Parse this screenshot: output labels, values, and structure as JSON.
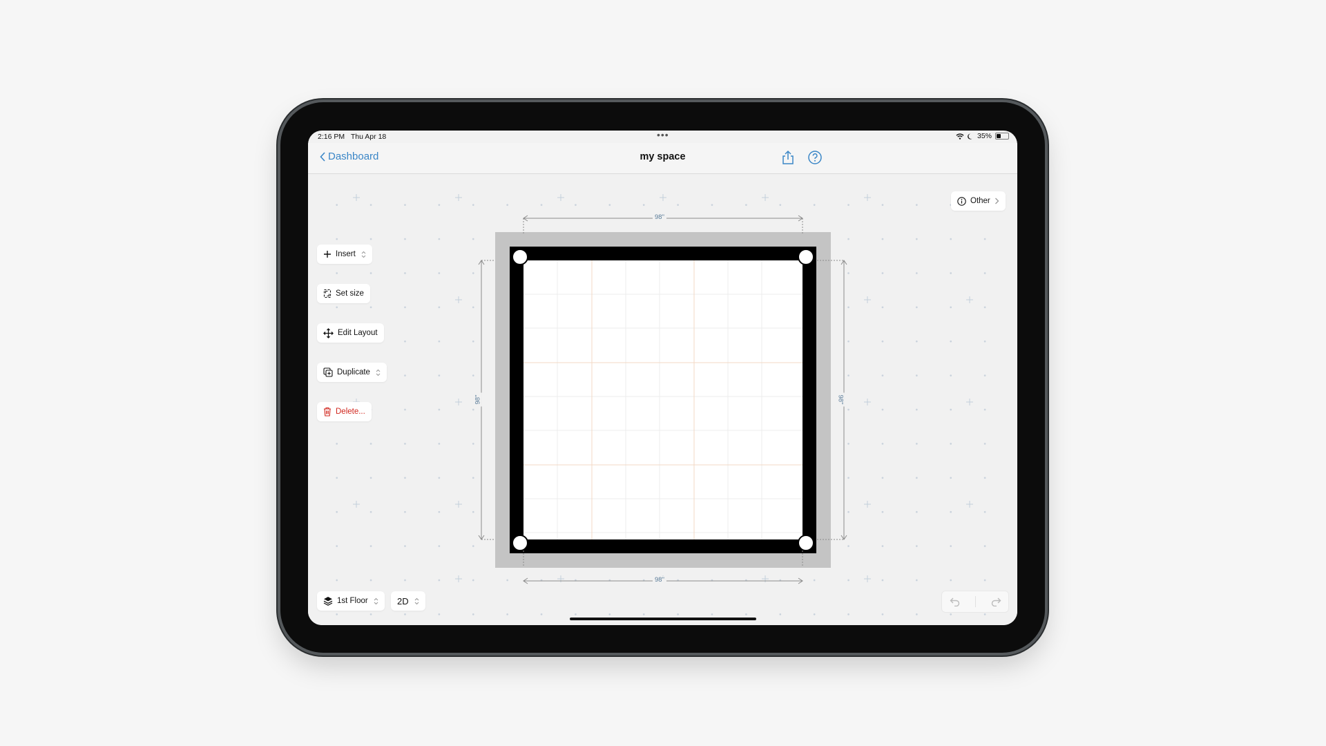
{
  "status_bar": {
    "time": "2:16 PM",
    "date": "Thu Apr 18",
    "battery_percent": "35%",
    "battery_level": 0.35,
    "multitasking_dots": "•••"
  },
  "nav": {
    "back_label": "Dashboard",
    "title": "my space"
  },
  "toolbar": {
    "insert_label": "Insert",
    "set_size_label": "Set size",
    "edit_layout_label": "Edit Layout",
    "duplicate_label": "Duplicate",
    "delete_label": "Delete..."
  },
  "other_button": {
    "label": "Other"
  },
  "room": {
    "dimensions": {
      "top": "98\"",
      "bottom": "98\"",
      "left": "98\"",
      "right": "98\""
    }
  },
  "bottom_bar": {
    "floor_label": "1st Floor",
    "view_mode_label": "2D"
  },
  "colors": {
    "accent": "#3a86c7",
    "danger": "#d0251c",
    "wall": "#000000",
    "wall_outline": "#c4c4c4",
    "grid_major": "#f3d9c4",
    "grid_minor": "#ececec"
  }
}
